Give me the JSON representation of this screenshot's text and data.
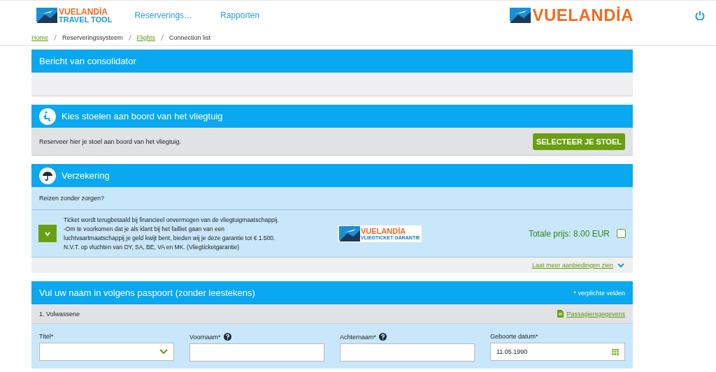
{
  "header": {
    "logo": {
      "brand": "VUELANDİA",
      "sub": "TRAVEL TOOL"
    },
    "nav": [
      "Reserverings…",
      "Rapporten"
    ],
    "brand_logo": "VUELANDİA"
  },
  "breadcrumb": [
    {
      "label": "Home",
      "link": true
    },
    {
      "label": "Reserveringssysteem",
      "link": false
    },
    {
      "label": "Flights",
      "link": true
    },
    {
      "label": "Connection list",
      "link": false
    }
  ],
  "consolidator": {
    "title": "Bericht van consolidator"
  },
  "seats": {
    "title": "Kies stoelen aan boord van het vliegtuig",
    "text": "Reserveer hier je stoel aan boord van het vliegtuig.",
    "button": "SELECTEER JE STOEL"
  },
  "insurance": {
    "title": "Verzekering",
    "question": "Reizen zonder zorgen?",
    "offer": {
      "expanded": false,
      "lines": [
        "Ticket wordt terugbetaald bij financieel onvermogen van de vliegtuigmaatschappij.",
        "-Om te voorkomen dat je als klant bij het failliet gaan van een",
        "luchtvaartmaatschappij je geld kwijt bent, bieden wij je deze garantie tot € 1.500.",
        "N.V.T. op vluchten van DY, SA, BE, VA en MK. (Vliegticketgarantie)"
      ],
      "logo": {
        "brand": "VUELANDİA",
        "sub": "VLIEGTICKET GARANTIE"
      },
      "price": "Totale prijs: 8.00 EUR",
      "checked": false
    },
    "more_link": "Laat meer aanbiedingen zien"
  },
  "passport": {
    "title": "Vul uw naam in volgens paspoort (zonder leestekens)",
    "note": "* verplichte velden",
    "passenger": "1. Volwassene",
    "details_link": "Passagiersgegevens",
    "fields": [
      {
        "kind": "select",
        "label": "Titel*",
        "help": false
      },
      {
        "kind": "text",
        "label": "Voornaam*",
        "help": true
      },
      {
        "kind": "text",
        "label": "Achternaam*",
        "help": true
      },
      {
        "kind": "date",
        "label": "Geboorte datum*",
        "help": false,
        "value": "11.05.1990"
      }
    ]
  }
}
